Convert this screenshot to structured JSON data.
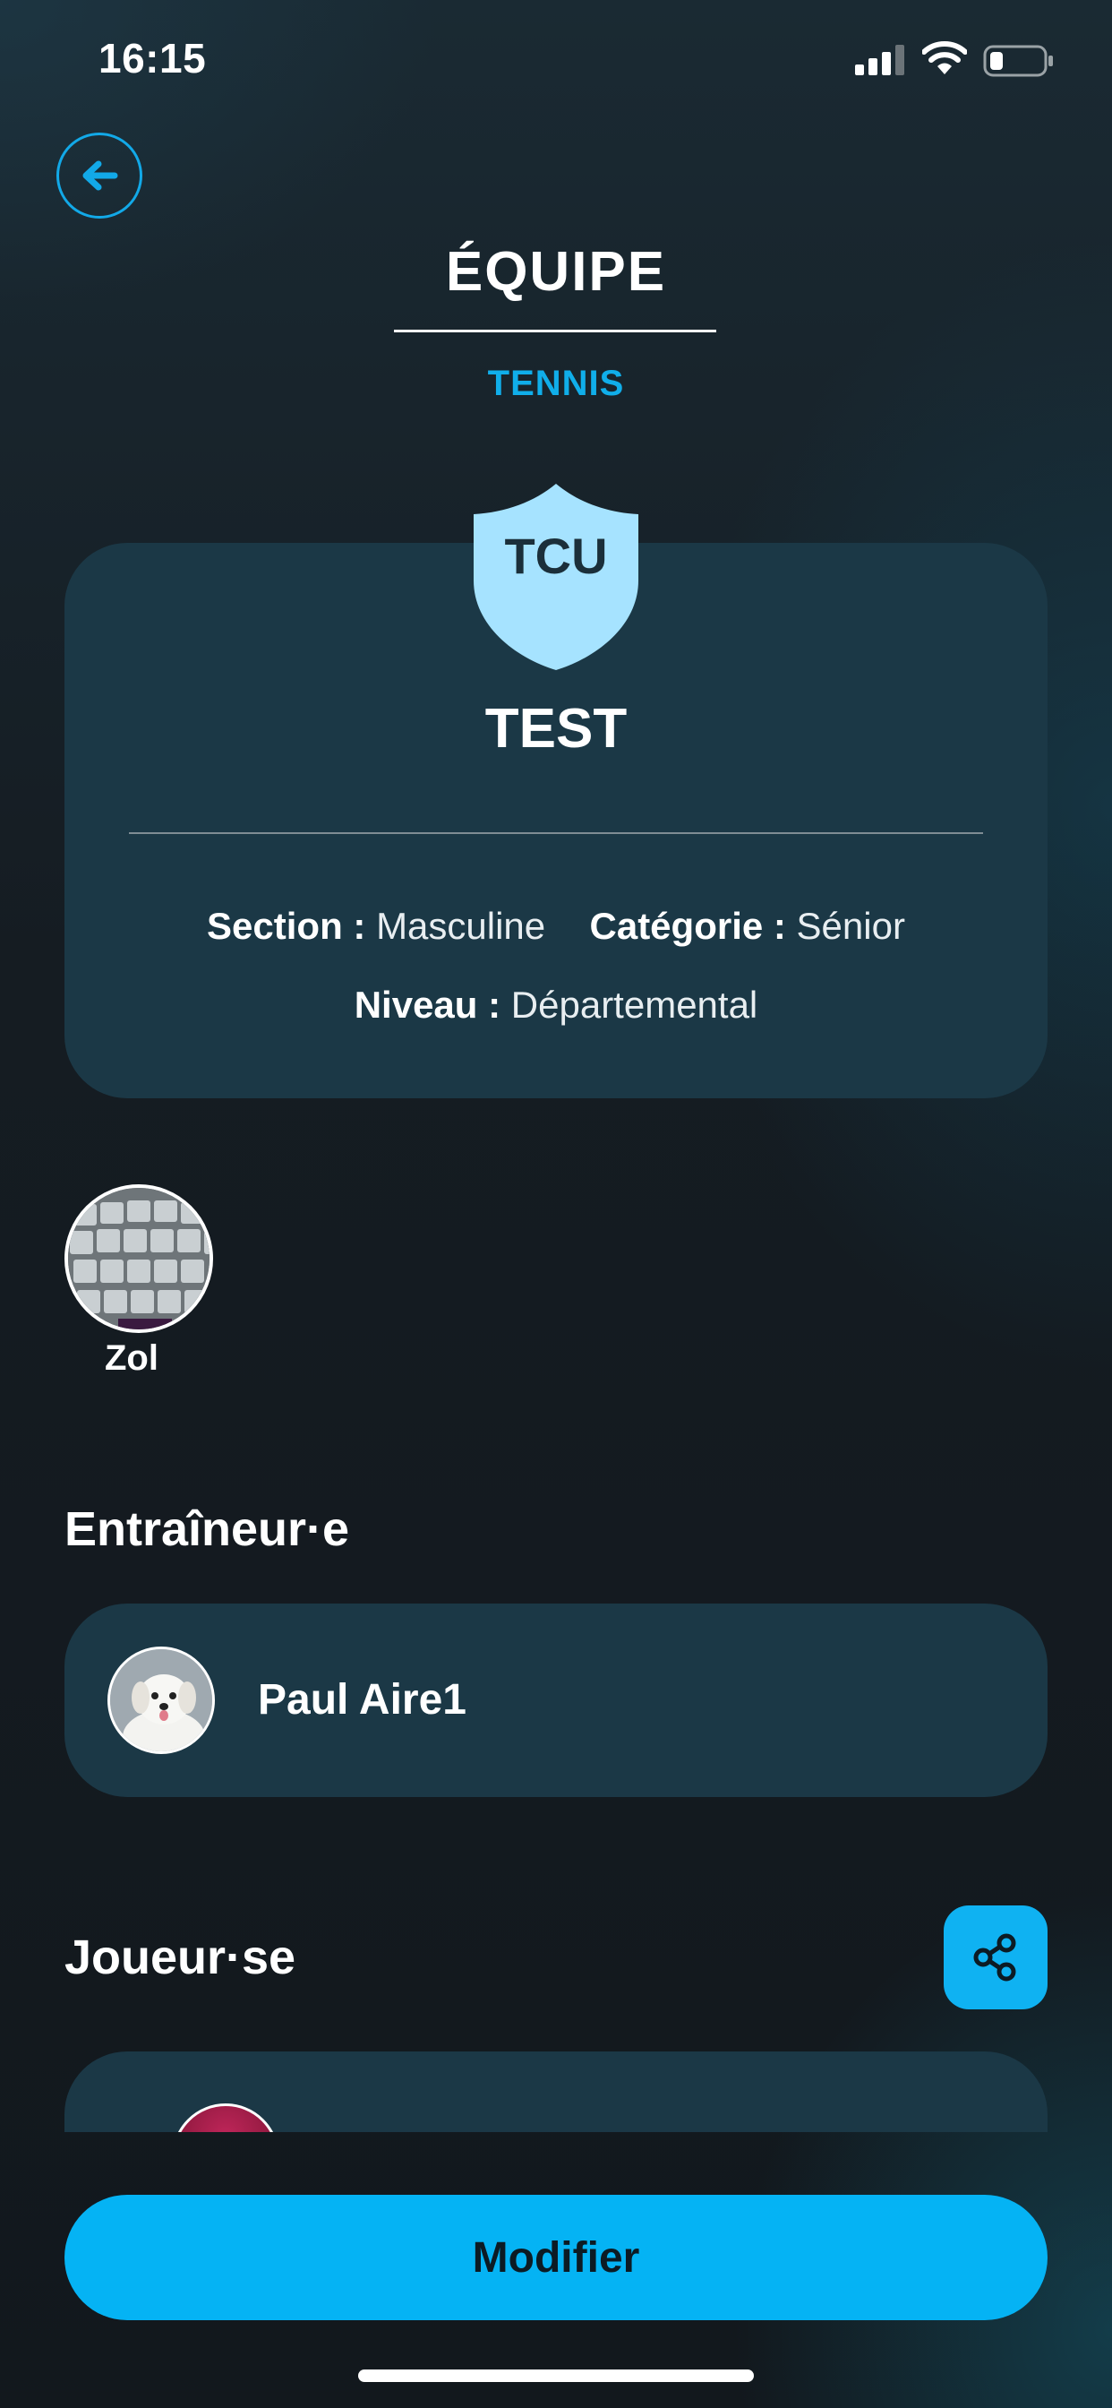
{
  "status_bar": {
    "time": "16:15"
  },
  "header": {
    "title": "ÉQUIPE",
    "subtitle": "TENNIS"
  },
  "team": {
    "badge_text": "TCU",
    "name": "TEST",
    "section_label": "Section :",
    "section_value": "Masculine",
    "category_label": "Catégorie :",
    "category_value": "Sénior",
    "level_label": "Niveau :",
    "level_value": "Départemental"
  },
  "member": {
    "name": "Zol"
  },
  "coaches": {
    "title": "Entraîneur·e",
    "items": [
      {
        "name": "Paul Aire1"
      }
    ]
  },
  "players": {
    "title": "Joueur·se"
  },
  "actions": {
    "modify_label": "Modifier"
  },
  "colors": {
    "accent": "#05b3f4",
    "card": "#1b3846",
    "shield": "#a6e3ff",
    "background": "#161c22"
  }
}
